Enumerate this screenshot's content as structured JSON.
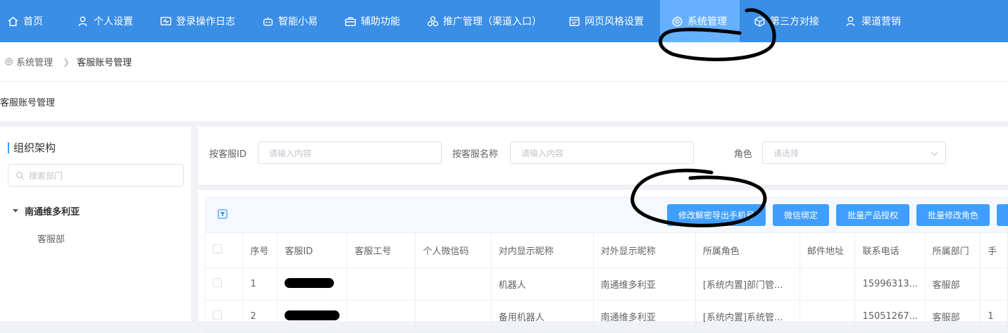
{
  "nav": {
    "items": [
      {
        "label": "首页",
        "icon": "home-icon"
      },
      {
        "label": "个人设置",
        "icon": "user-icon"
      },
      {
        "label": "登录操作日志",
        "icon": "monitor-icon"
      },
      {
        "label": "智能小易",
        "icon": "robot-icon"
      },
      {
        "label": "辅助功能",
        "icon": "toolbox-icon"
      },
      {
        "label": "推广管理（渠道入口）",
        "icon": "network-icon"
      },
      {
        "label": "网页风格设置",
        "icon": "window-icon"
      },
      {
        "label": "系统管理",
        "icon": "gear-icon"
      },
      {
        "label": "第三方对接",
        "icon": "cube-icon"
      },
      {
        "label": "渠道营销",
        "icon": "user-icon"
      }
    ],
    "active_index": 7
  },
  "breadcrumb": {
    "root": "系统管理",
    "current": "客服账号管理"
  },
  "page_title": "客服账号管理",
  "org": {
    "title": "组织架构",
    "search_placeholder": "搜索部门",
    "root": "南通维多利亚",
    "child": "客服部"
  },
  "filters": {
    "id_label": "按客服ID",
    "id_placeholder": "请输入内容",
    "name_label": "按客服名称",
    "name_placeholder": "请输入内容",
    "role_label": "角色",
    "role_placeholder": "请选择"
  },
  "toolbar": {
    "buttons": [
      "修改解密导出手机号",
      "微信绑定",
      "批量产品授权",
      "批量修改角色"
    ]
  },
  "table": {
    "headers": [
      "序号",
      "客服ID",
      "客服工号",
      "个人微信码",
      "对内显示昵称",
      "对外显示昵称",
      "所属角色",
      "邮件地址",
      "联系电话",
      "所属部门",
      "手"
    ],
    "rows": [
      {
        "index": "1",
        "staff_no": "",
        "wechat": "",
        "inner_name": "机器人",
        "outer_name": "南通维多利亚",
        "role": "[系统内置]部门管...",
        "email": "",
        "phone": "15996313...",
        "dept": "客服部",
        "extra": ""
      },
      {
        "index": "2",
        "staff_no": "",
        "wechat": "",
        "inner_name": "备用机器人",
        "outer_name": "南通维多利亚",
        "role": "[系统内置]系统管...",
        "email": "",
        "phone": "15051267...",
        "dept": "客服部",
        "extra": "1"
      }
    ]
  },
  "colors": {
    "nav_bg": "#3a8ee6",
    "nav_active": "#66b1ff",
    "primary": "#409eff"
  }
}
